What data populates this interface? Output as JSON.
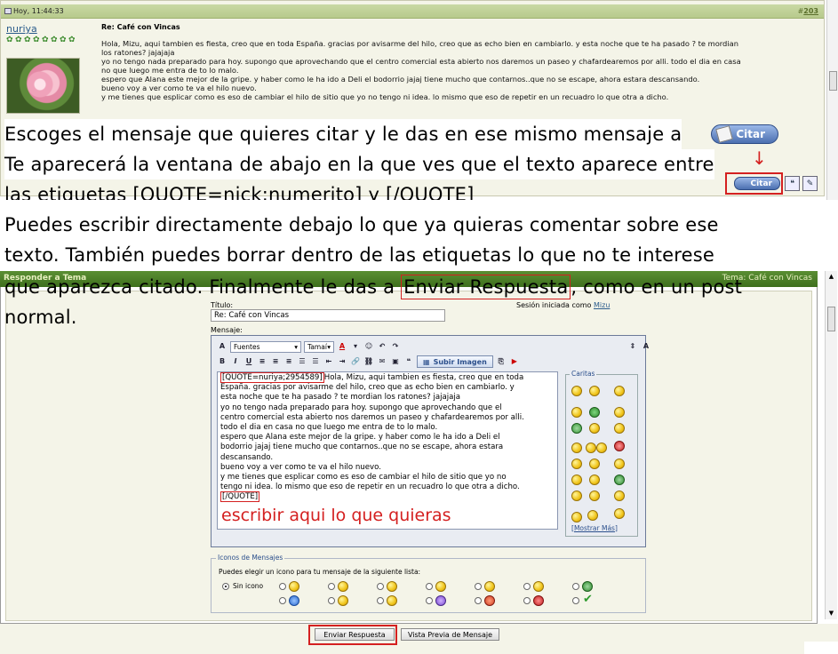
{
  "post": {
    "date": "Hoy, 11:44:33",
    "number_prefix": "#",
    "number": "203",
    "username": "nuriya",
    "title": "Re: Café con Vincas",
    "body_lines": [
      "Hola, Mizu, aqui tambien es fiesta, creo que en toda España. gracias por avisarme del hilo, creo que as echo bien en cambiarlo. y esta noche que te ha pasado ? te mordian",
      "los ratones? jajajaja",
      "yo no tengo nada preparado para hoy. supongo que aprovechando que el centro comercial esta abierto nos daremos un paseo y chafardearemos por alli. todo el dia en casa",
      "no que luego me entra de to lo malo.",
      "espero que Alana este mejor de la gripe. y haber como le ha ido a Deli el bodorrio jajaj tiene mucho que contarnos..que no se escape, ahora estara descansando.",
      "bueno voy a ver como te va el hilo nuevo.",
      "y me tienes que esplicar como es eso de cambiar el hilo de sitio que yo no tengo ni idea. lo mismo que eso de repetir en un recuadro lo que otra a dicho."
    ],
    "citar_label": "Citar"
  },
  "tutorial": {
    "line1": "Escoges el mensaje que quieres citar y le das en ese mismo mensaje a",
    "line2": "Te aparecerá la ventana de abajo en la que ves que el texto aparece entre",
    "line3": "las etiquetas [QUOTE=nick;numerito] y [/QUOTE]",
    "line4": "Puedes escribir directamente debajo lo que ya quieras comentar sobre ese",
    "line5": "texto. También puedes borrar dentro de las etiquetas lo que no te interese",
    "line6_a": "que aparezca citado. Finalmente le das a ",
    "line6_hl": "Enviar Respuesta",
    "line6_b": ", como en un post",
    "line7": "normal.",
    "arrow": "↓"
  },
  "reply": {
    "header_left": "Responder a Tema",
    "header_right": "Tema: Café con Vincas",
    "title_label": "Título:",
    "title_value": "Re: Café con Vincas",
    "session_text": "Sesión iniciada como",
    "session_user": "Mizu",
    "message_label": "Mensaje:",
    "font_select": "Fuentes",
    "size_select": "Tamaí",
    "upload_label": "Subir Imagen",
    "quote_open": "[QUOTE=nuriya;2954589]",
    "quote_close": "[/QUOTE]",
    "text_first": "Hola, Mizu, aqui tambien es fiesta, creo que en toda",
    "text_lines": [
      "España. gracias por avisarme del hilo, creo que as echo bien en cambiarlo. y",
      "esta noche que te ha pasado ? te mordian los ratones? jajajaja",
      "yo no tengo nada preparado para hoy. supongo que aprovechando que el",
      "centro comercial esta abierto nos daremos un paseo y chafardearemos por alli.",
      "todo el dia en casa no que luego me entra de to lo malo.",
      "espero que Alana este mejor de la gripe. y haber como le ha ido a Deli el",
      "bodorrio jajaj tiene mucho que contarnos..que no se escape, ahora estara",
      "descansando.",
      "bueno voy a ver como te va el hilo nuevo.",
      "y me tienes que esplicar como es eso de cambiar el hilo de sitio que yo no",
      "tengo ni idea. lo mismo que eso de repetir en un recuadro lo que otra a dicho."
    ],
    "write_here": "escribir aqui lo que quieras",
    "caritas_label": "Caritas",
    "mostrar_mas": "Mostrar Más",
    "icons_legend": "Iconos de Mensajes",
    "icons_desc": "Puedes elegir un icono para tu mensaje de la siguiente lista:",
    "sin_icono": "Sin icono",
    "send_button": "Enviar Respuesta",
    "preview_button": "Vista Previa de Mensaje"
  },
  "colors": {
    "highlight_red": "#d42020",
    "header_green": "#4e7f28",
    "panel_bg": "#f4f4e8",
    "link_blue": "#2b5c8c"
  }
}
